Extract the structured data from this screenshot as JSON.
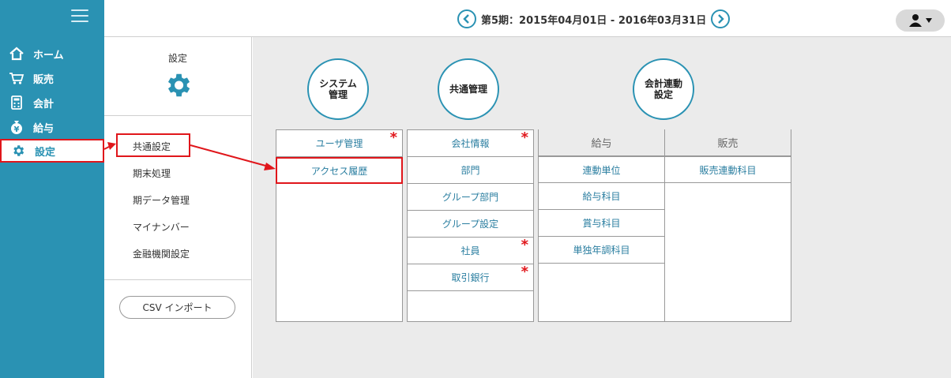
{
  "sidebar": {
    "items": [
      {
        "label": "ホーム",
        "icon": "home-icon"
      },
      {
        "label": "販売",
        "icon": "cart-icon"
      },
      {
        "label": "会計",
        "icon": "calculator-icon"
      },
      {
        "label": "給与",
        "icon": "yen-bag-icon"
      },
      {
        "label": "設定",
        "icon": "gear-icon",
        "active": true
      }
    ]
  },
  "header": {
    "period": "第5期：2015年04月01日 - 2016年03月31日"
  },
  "settings_panel": {
    "title": "設定",
    "items": [
      "共通設定",
      "期末処理",
      "期データ管理",
      "マイナンバー",
      "金融機関設定"
    ],
    "csv_button": "CSV インポート"
  },
  "categories": {
    "system": "システム管理",
    "common": "共通管理",
    "accounting_link": "会計連動設定"
  },
  "columns": {
    "system": {
      "items": [
        {
          "label": "ユーザ管理",
          "required": true
        },
        {
          "label": "アクセス履歴",
          "required": false
        }
      ]
    },
    "common": {
      "items": [
        {
          "label": "会社情報",
          "required": true
        },
        {
          "label": "部門",
          "required": false
        },
        {
          "label": "グループ部門",
          "required": false
        },
        {
          "label": "グループ設定",
          "required": false
        },
        {
          "label": "社員",
          "required": true
        },
        {
          "label": "取引銀行",
          "required": true
        }
      ]
    },
    "payroll": {
      "header": "給与",
      "items": [
        "連動単位",
        "給与科目",
        "賞与科目",
        "単独年調科目"
      ]
    },
    "sales": {
      "header": "販売",
      "items": [
        "販売連動科目"
      ]
    }
  },
  "colors": {
    "accent": "#2a92b3",
    "highlight": "#e0161b",
    "required_star": "#e0161b"
  }
}
